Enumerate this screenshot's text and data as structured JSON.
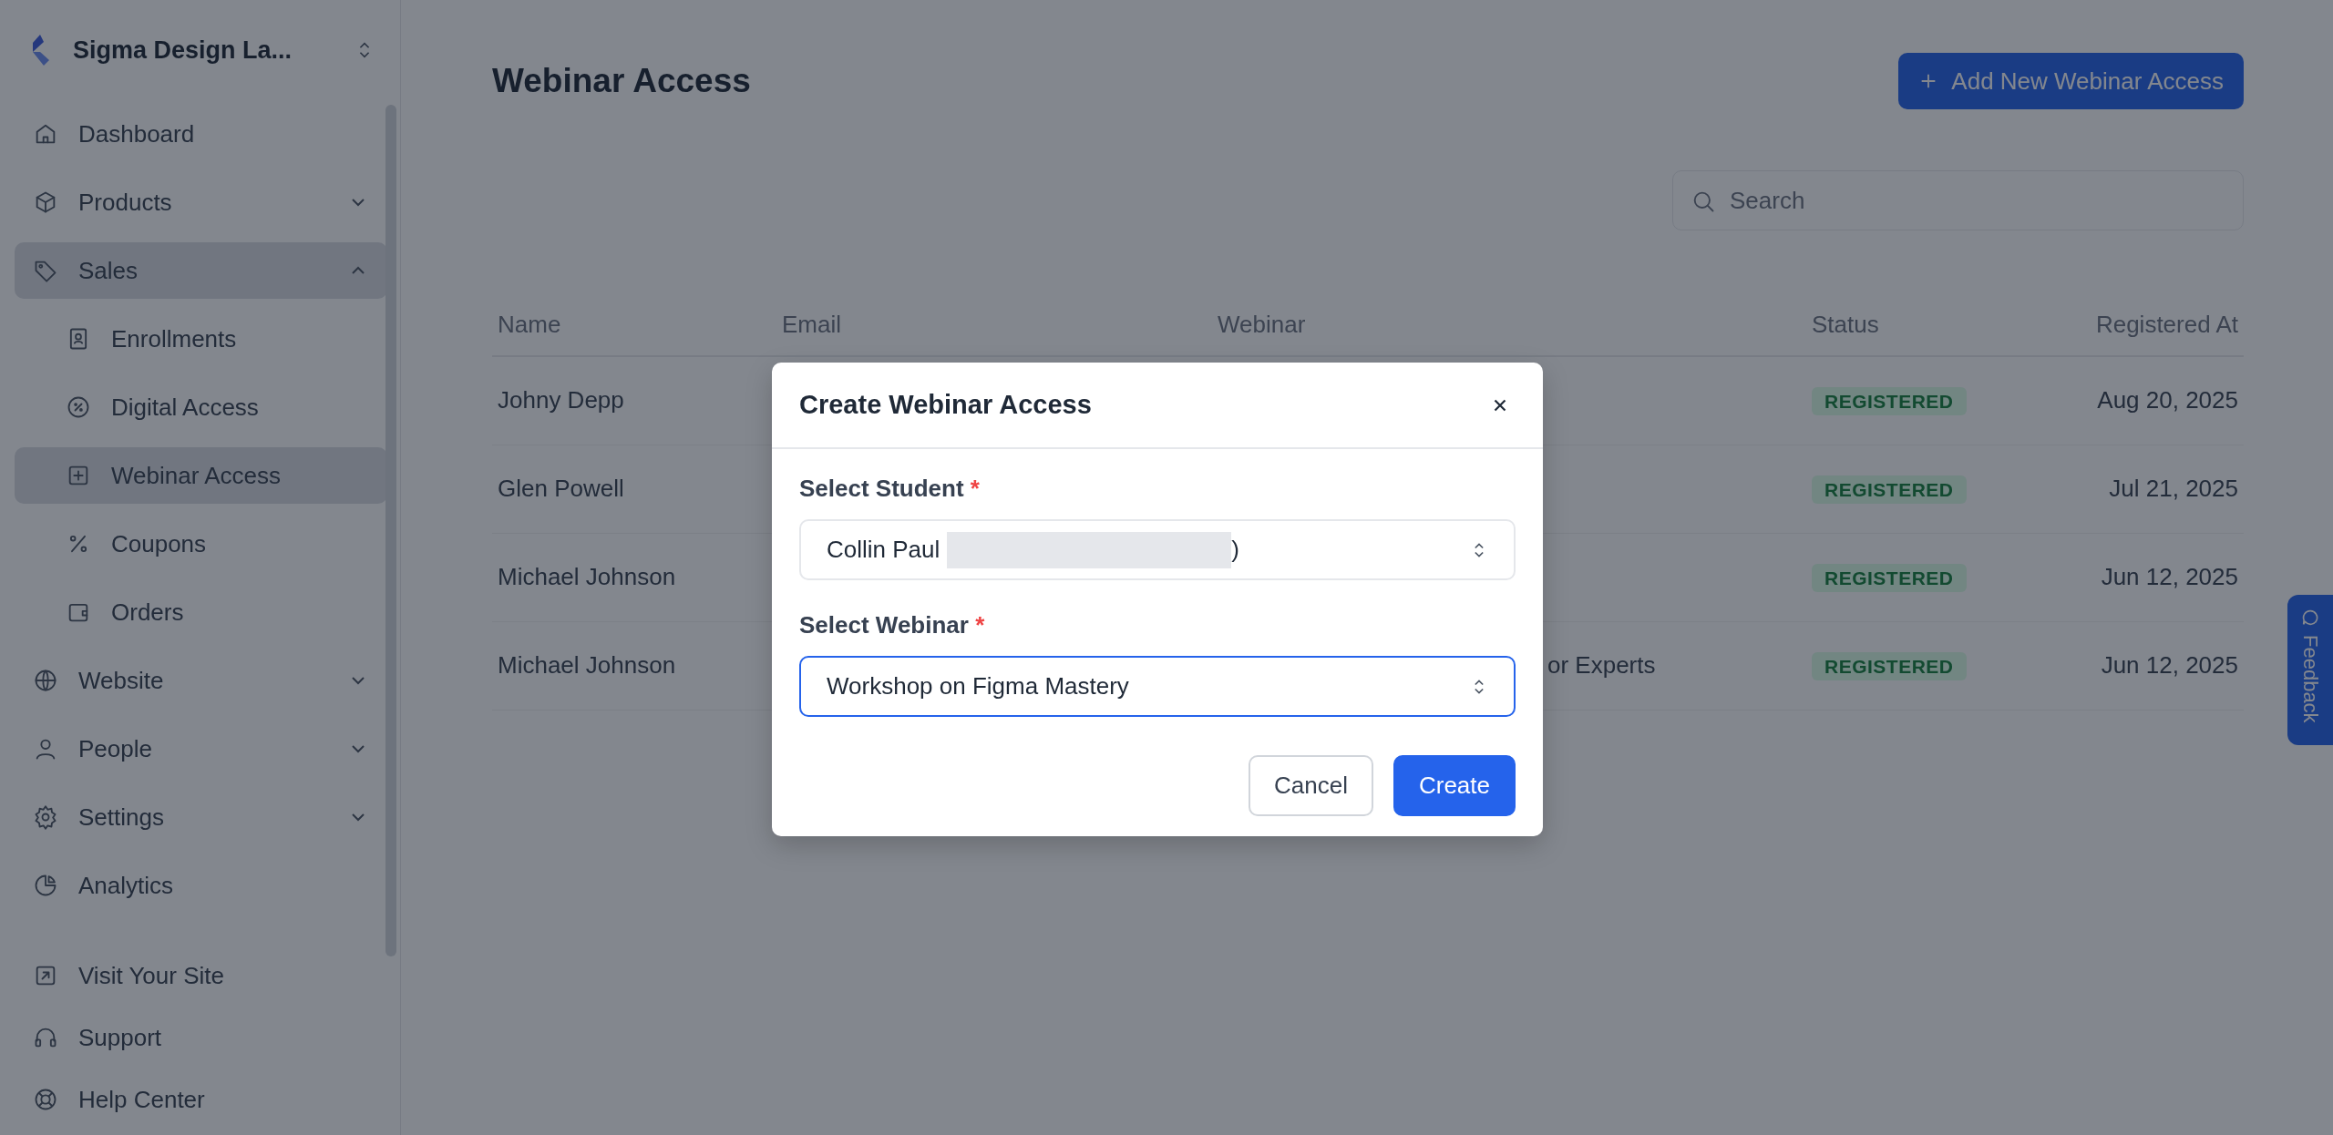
{
  "sidebar": {
    "brand": "Sigma Design La...",
    "items": [
      {
        "label": "Dashboard",
        "selected": false
      },
      {
        "label": "Products",
        "selected": false,
        "expanded": false
      },
      {
        "label": "Sales",
        "selected": true,
        "expanded": true,
        "children": [
          {
            "label": "Enrollments",
            "selected": false
          },
          {
            "label": "Digital Access",
            "selected": false
          },
          {
            "label": "Webinar Access",
            "selected": true
          },
          {
            "label": "Coupons",
            "selected": false
          },
          {
            "label": "Orders",
            "selected": false
          }
        ]
      },
      {
        "label": "Website",
        "selected": false,
        "expanded": false
      },
      {
        "label": "People",
        "selected": false,
        "expanded": false
      },
      {
        "label": "Settings",
        "selected": false,
        "expanded": false
      },
      {
        "label": "Analytics",
        "selected": false
      }
    ],
    "footer_links": [
      "Visit Your Site",
      "Support",
      "Help Center"
    ]
  },
  "page": {
    "title": "Webinar Access",
    "add_button": "Add New Webinar Access",
    "search": {
      "placeholder": "Search"
    }
  },
  "table": {
    "columns": [
      "Name",
      "Email",
      "Webinar",
      "Status",
      "Registered At"
    ],
    "rows": [
      {
        "name": "Johny Depp",
        "status": "REGISTERED",
        "registered_at": "Aug 20, 2025"
      },
      {
        "name": "Glen Powell",
        "status": "REGISTERED",
        "registered_at": "Jul 21, 2025"
      },
      {
        "name": "Michael Johnson",
        "status": "REGISTERED",
        "registered_at": "Jun 12, 2025"
      },
      {
        "name": "Michael Johnson",
        "webinar": "or Experts",
        "status": "REGISTERED",
        "registered_at": "Jun 12, 2025"
      }
    ]
  },
  "modal": {
    "title": "Create Webinar Access",
    "fields": [
      {
        "label": "Select Student",
        "required_mark": "*",
        "value": "Collin Paul",
        "redacted": true,
        "value_suffix": ")",
        "focused": false
      },
      {
        "label": "Select Webinar",
        "required_mark": "*",
        "value": "Workshop on Figma Mastery",
        "focused": true
      }
    ],
    "buttons": [
      {
        "label": "Cancel",
        "kind": "secondary"
      },
      {
        "label": "Create",
        "kind": "primary"
      }
    ]
  },
  "feedback_tab": "Feedback"
}
